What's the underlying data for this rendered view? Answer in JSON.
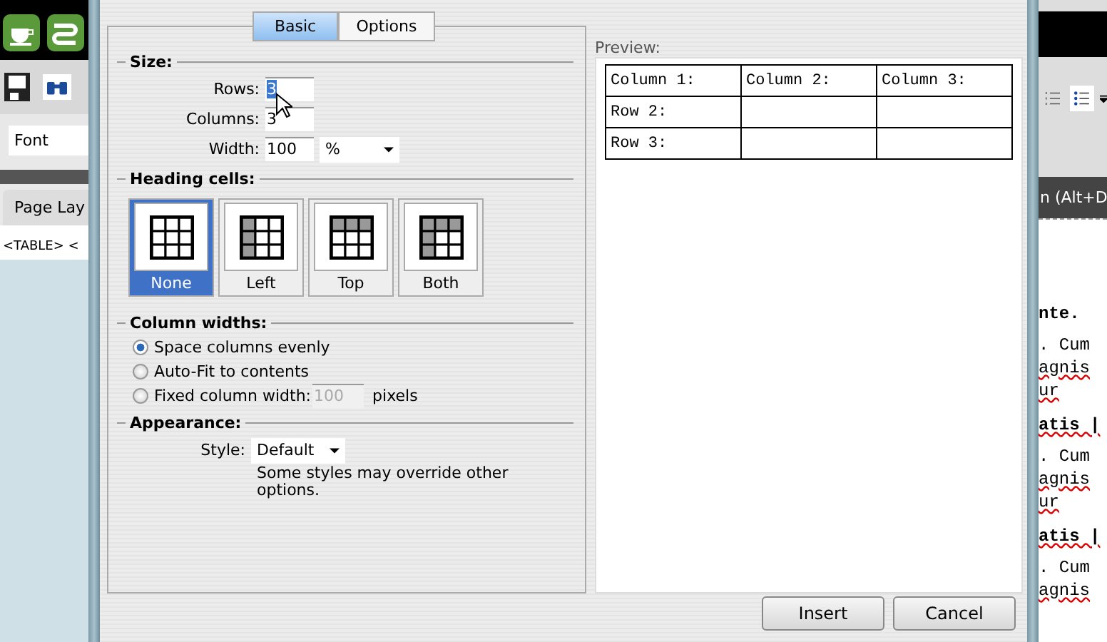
{
  "background_left": {
    "font_field": "Font",
    "tab": "Page Lay",
    "tag_path": "<TABLE>  <"
  },
  "dialog": {
    "tabs": [
      {
        "label": "Basic",
        "selected": true
      },
      {
        "label": "Options",
        "selected": false
      }
    ],
    "size": {
      "title": "Size:",
      "rows_label": "Rows:",
      "rows_value": "3",
      "columns_label": "Columns:",
      "columns_value": "3",
      "width_label": "Width:",
      "width_value": "100",
      "width_unit": "%"
    },
    "heading_cells": {
      "title": "Heading cells:",
      "options": [
        {
          "label": "None",
          "kind": "none",
          "selected": true
        },
        {
          "label": "Left",
          "kind": "left",
          "selected": false
        },
        {
          "label": "Top",
          "kind": "top",
          "selected": false
        },
        {
          "label": "Both",
          "kind": "both",
          "selected": false
        }
      ]
    },
    "column_widths": {
      "title": "Column widths:",
      "options": [
        {
          "label": "Space columns evenly",
          "selected": true
        },
        {
          "label": "Auto-Fit to contents",
          "selected": false
        },
        {
          "label": "Fixed column width:",
          "selected": false,
          "value": "100",
          "unit": "pixels",
          "disabled": true
        }
      ]
    },
    "appearance": {
      "title": "Appearance:",
      "style_label": "Style:",
      "style_value": "Default",
      "note": "Some styles may override other options."
    },
    "preview": {
      "title": "Preview:",
      "rows": [
        [
          "Column 1:",
          "Column 2:",
          "Column 3:"
        ],
        [
          "Row 2:"
        ],
        [
          "Row 3:"
        ]
      ]
    },
    "buttons": [
      "Insert",
      "Cancel"
    ]
  },
  "background_right": {
    "tab": "n (Alt+D",
    "document_lines": [
      {
        "text": "nte.",
        "kind": "heading",
        "misspelled": false
      },
      {
        "text": ". Cum",
        "kind": "text",
        "misspelled": false
      },
      {
        "text": "agnis",
        "kind": "text",
        "misspelled": true
      },
      {
        "text": "ur",
        "kind": "text",
        "misspelled": true
      },
      {
        "text": "atis |",
        "kind": "heading",
        "misspelled": true
      },
      {
        "text": ". Cum",
        "kind": "text",
        "misspelled": false
      },
      {
        "text": "agnis",
        "kind": "text",
        "misspelled": true
      },
      {
        "text": "ur",
        "kind": "text",
        "misspelled": true
      },
      {
        "text": "atis |",
        "kind": "heading",
        "misspelled": true
      },
      {
        "text": ". Cum",
        "kind": "text",
        "misspelled": false
      },
      {
        "text": "agnis",
        "kind": "text",
        "misspelled": true
      }
    ]
  }
}
